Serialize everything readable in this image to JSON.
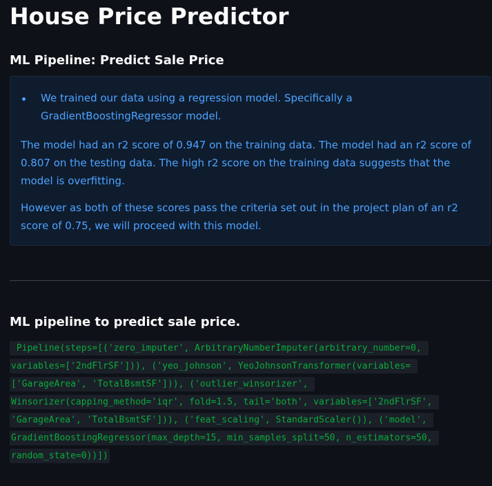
{
  "page": {
    "title": "House Price Predictor",
    "subtitle": "ML Pipeline: Predict Sale Price"
  },
  "info": {
    "bullet": "We trained our data using a regression model. Specifically a GradientBoostingRegressor model.",
    "paragraph1": "The model had an r2 score of 0.947 on the training data. The model had an r2 score of 0.807 on the testing data. The high r2 score on the training data suggests that the model is overfitting.",
    "paragraph2": "However as both of these scores pass the criteria set out in the project plan of an r2 score of 0.75, we will proceed with this model."
  },
  "pipeline": {
    "heading": "ML pipeline to predict sale price.",
    "code": " Pipeline(steps=[('zero_imputer', ArbitraryNumberImputer(arbitrary_number=0, variables=['2ndFlrSF'])), ('yeo_johnson', YeoJohnsonTransformer(variables= ['GarageArea', 'TotalBsmtSF'])), ('outlier_winsorizer', Winsorizer(capping_method='iqr', fold=1.5, tail='both', variables=['2ndFlrSF', 'GarageArea', 'TotalBsmtSF'])), ('feat_scaling', StandardScaler()), ('model', GradientBoostingRegressor(max_depth=15, min_samples_split=50, n_estimators=50, random_state=0))])"
  },
  "colors": {
    "background": "#0e1117",
    "info_background": "#0f1c2e",
    "info_text": "#4da3ff",
    "code_text": "#09ab3b",
    "code_background": "#1b1f28",
    "divider": "#3d4250"
  }
}
